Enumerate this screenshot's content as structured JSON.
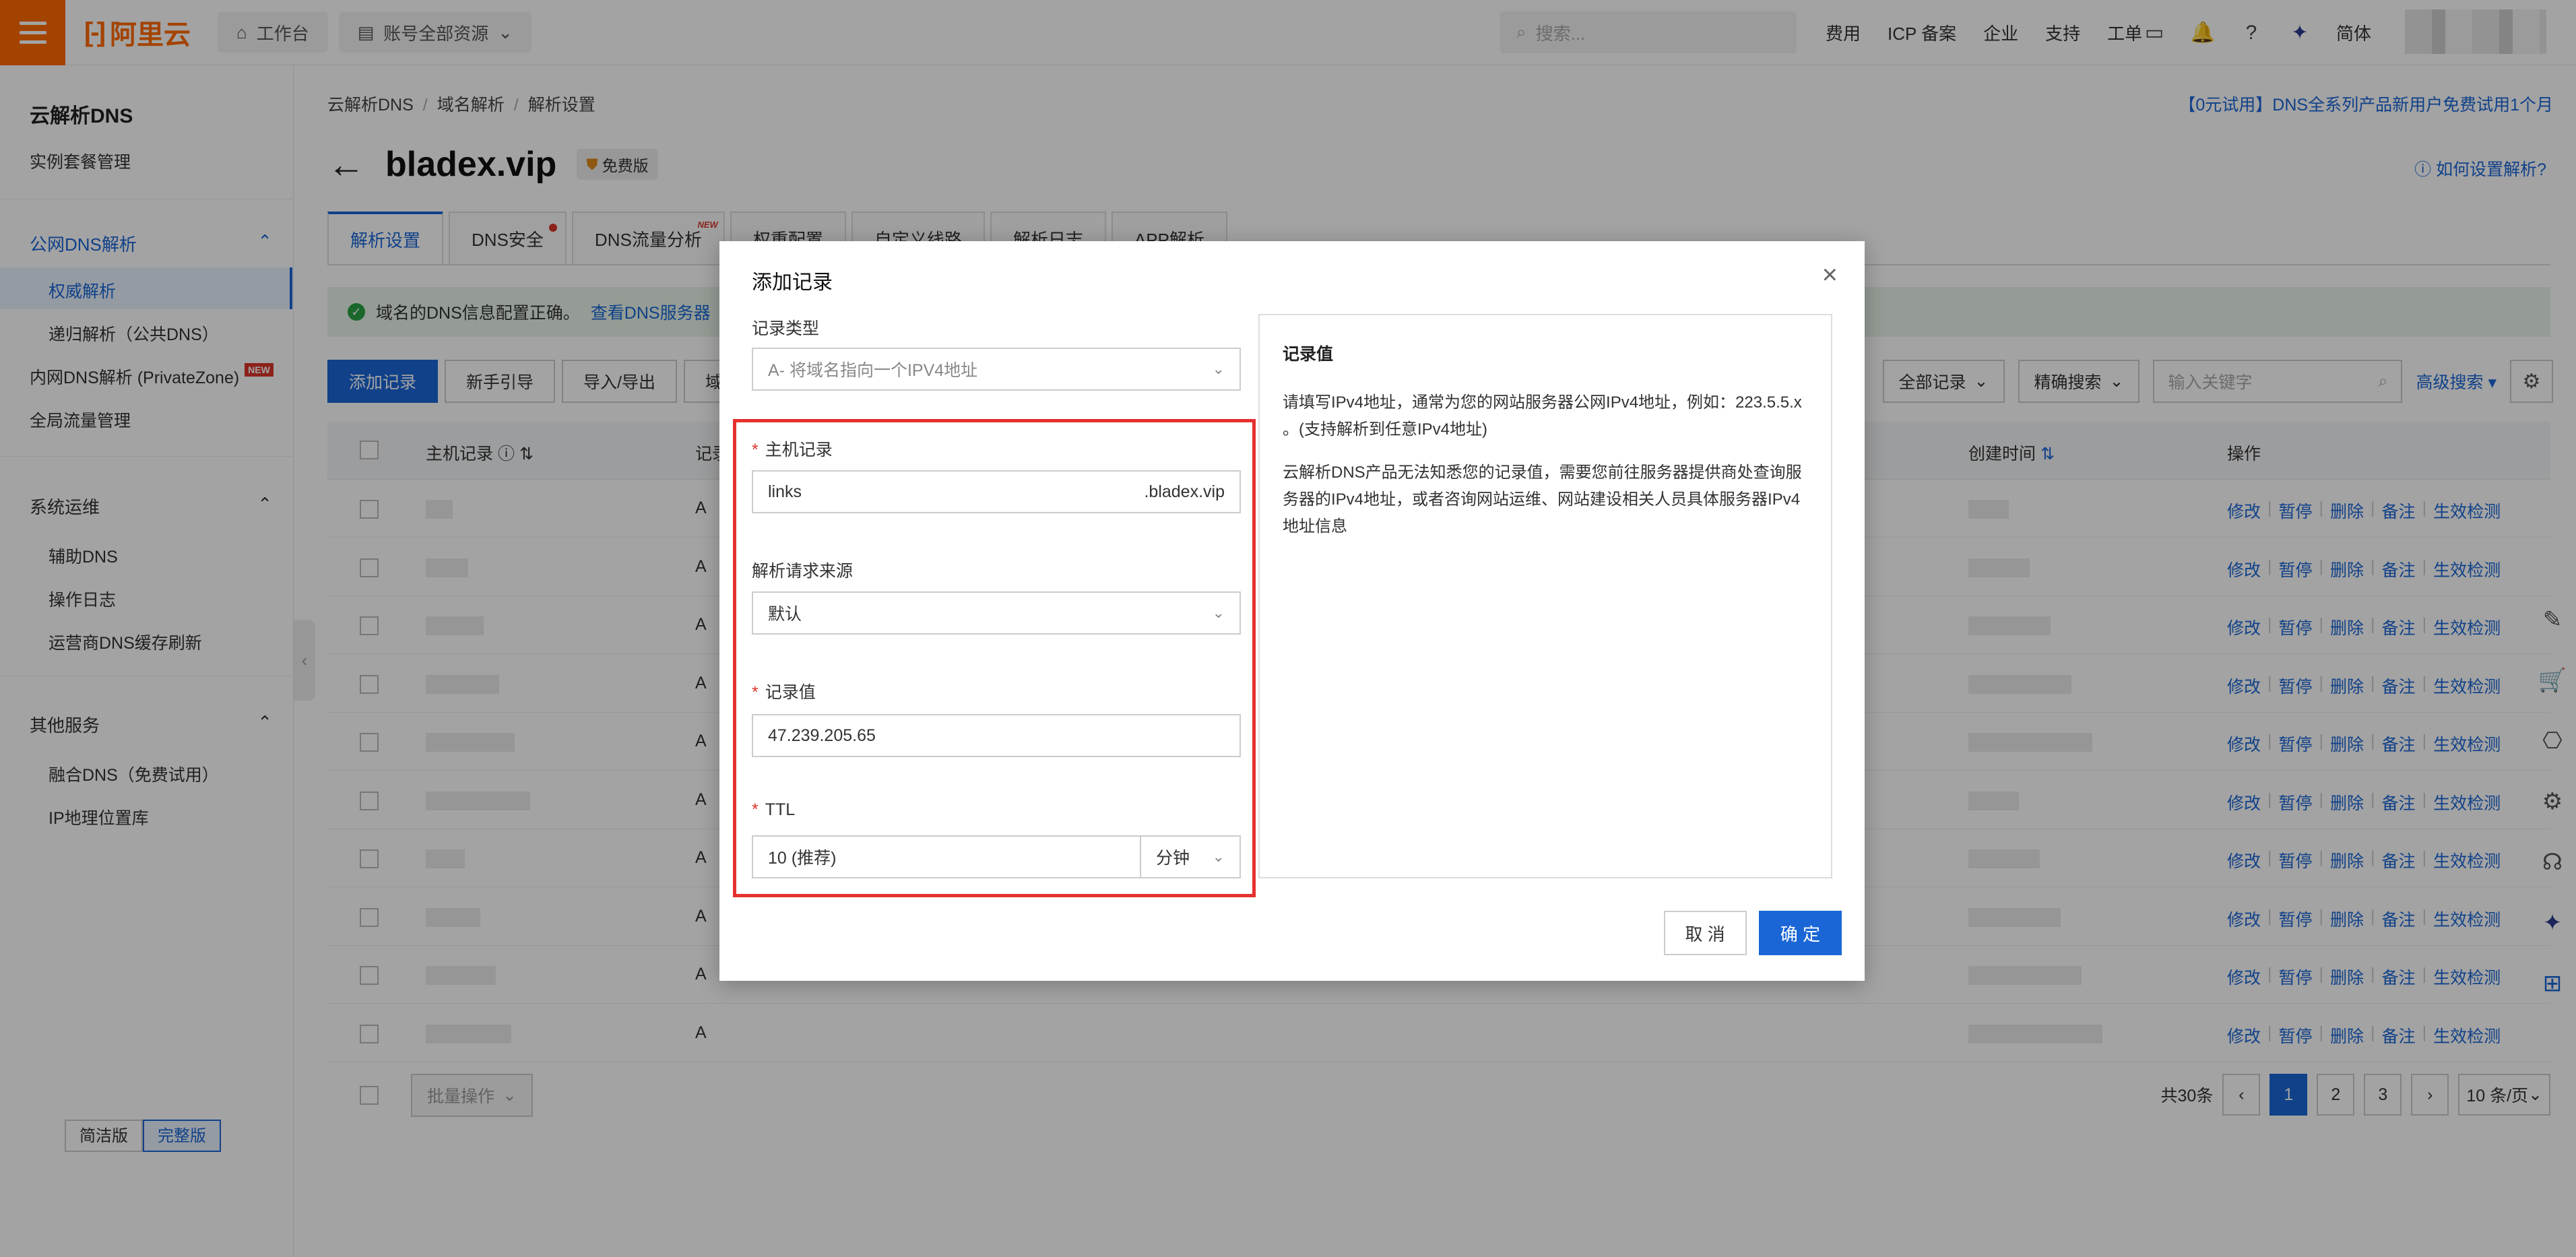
{
  "topbar": {
    "brand": "阿里云",
    "workbench": "工作台",
    "account_resources": "账号全部资源",
    "search_placeholder": "搜索...",
    "links": [
      "费用",
      "ICP 备案",
      "企业",
      "支持",
      "工单"
    ],
    "lang": "简体"
  },
  "sidebar": {
    "title": "云解析DNS",
    "instance_mgmt": "实例套餐管理",
    "group_public": "公网DNS解析",
    "authoritative": "权威解析",
    "recursive": "递归解析（公共DNS）",
    "privatezone": "内网DNS解析 (PrivateZone)",
    "new_tag": "NEW",
    "gtm": "全局流量管理",
    "group_ops": "系统运维",
    "aux_dns": "辅助DNS",
    "op_log": "操作日志",
    "isp_refresh": "运营商DNS缓存刷新",
    "group_other": "其他服务",
    "fusion_dns": "融合DNS（免费试用）",
    "ip_geo": "IP地理位置库",
    "simple": "简洁版",
    "full": "完整版"
  },
  "main": {
    "breadcrumb": [
      "云解析DNS",
      "域名解析",
      "解析设置"
    ],
    "promo": "【0元试用】DNS全系列产品新用户免费试用1个月",
    "domain": "bladex.vip",
    "free_badge": "免费版",
    "help": "如何设置解析?",
    "tabs": [
      {
        "label": "解析设置"
      },
      {
        "label": "DNS安全"
      },
      {
        "label": "DNS流量分析"
      },
      {
        "label": "权重配置"
      },
      {
        "label": "自定义线路"
      },
      {
        "label": "解析日志"
      },
      {
        "label": "APP解析"
      }
    ],
    "tab_new": "NEW",
    "notice_text": "域名的DNS信息配置正确。",
    "notice_link": "查看DNS服务器",
    "toolbar": {
      "add": "添加记录",
      "guide": "新手引导",
      "import_export": "导入/导出",
      "more": "域名",
      "all_records": "全部记录",
      "exact_search": "精确搜索",
      "keyword_placeholder": "输入关键字",
      "advanced": "高级搜索"
    },
    "table": {
      "col_host": "主机记录",
      "col_type": "记录",
      "col_created": "创建时间",
      "col_ops": "操作",
      "record_type": "A",
      "ops": [
        "修改",
        "暂停",
        "删除",
        "备注",
        "生效检测"
      ]
    },
    "batch": "批量操作",
    "total": "共30条",
    "pages": [
      "1",
      "2",
      "3"
    ],
    "per_page": "10 条/页"
  },
  "modal": {
    "title": "添加记录",
    "record_type_label": "记录类型",
    "record_type_value": "A- 将域名指向一个IPV4地址",
    "host_label": "主机记录",
    "host_value": "links",
    "host_suffix": ".bladex.vip",
    "source_label": "解析请求来源",
    "source_value": "默认",
    "value_label": "记录值",
    "value_value": "47.239.205.65",
    "ttl_label": "TTL",
    "ttl_value": "10 (推荐)",
    "ttl_unit": "分钟",
    "info_title": "记录值",
    "info_p1": "请填写IPv4地址，通常为您的网站服务器公网IPv4地址，例如：223.5.5.x 。(支持解析到任意IPv4地址)",
    "info_p2": "云解析DNS产品无法知悉您的记录值，需要您前往服务器提供商处查询服务器的IPv4地址，或者咨询网站运维、网站建设相关人员具体服务器IPv4地址信息",
    "cancel": "取 消",
    "confirm": "确 定"
  }
}
